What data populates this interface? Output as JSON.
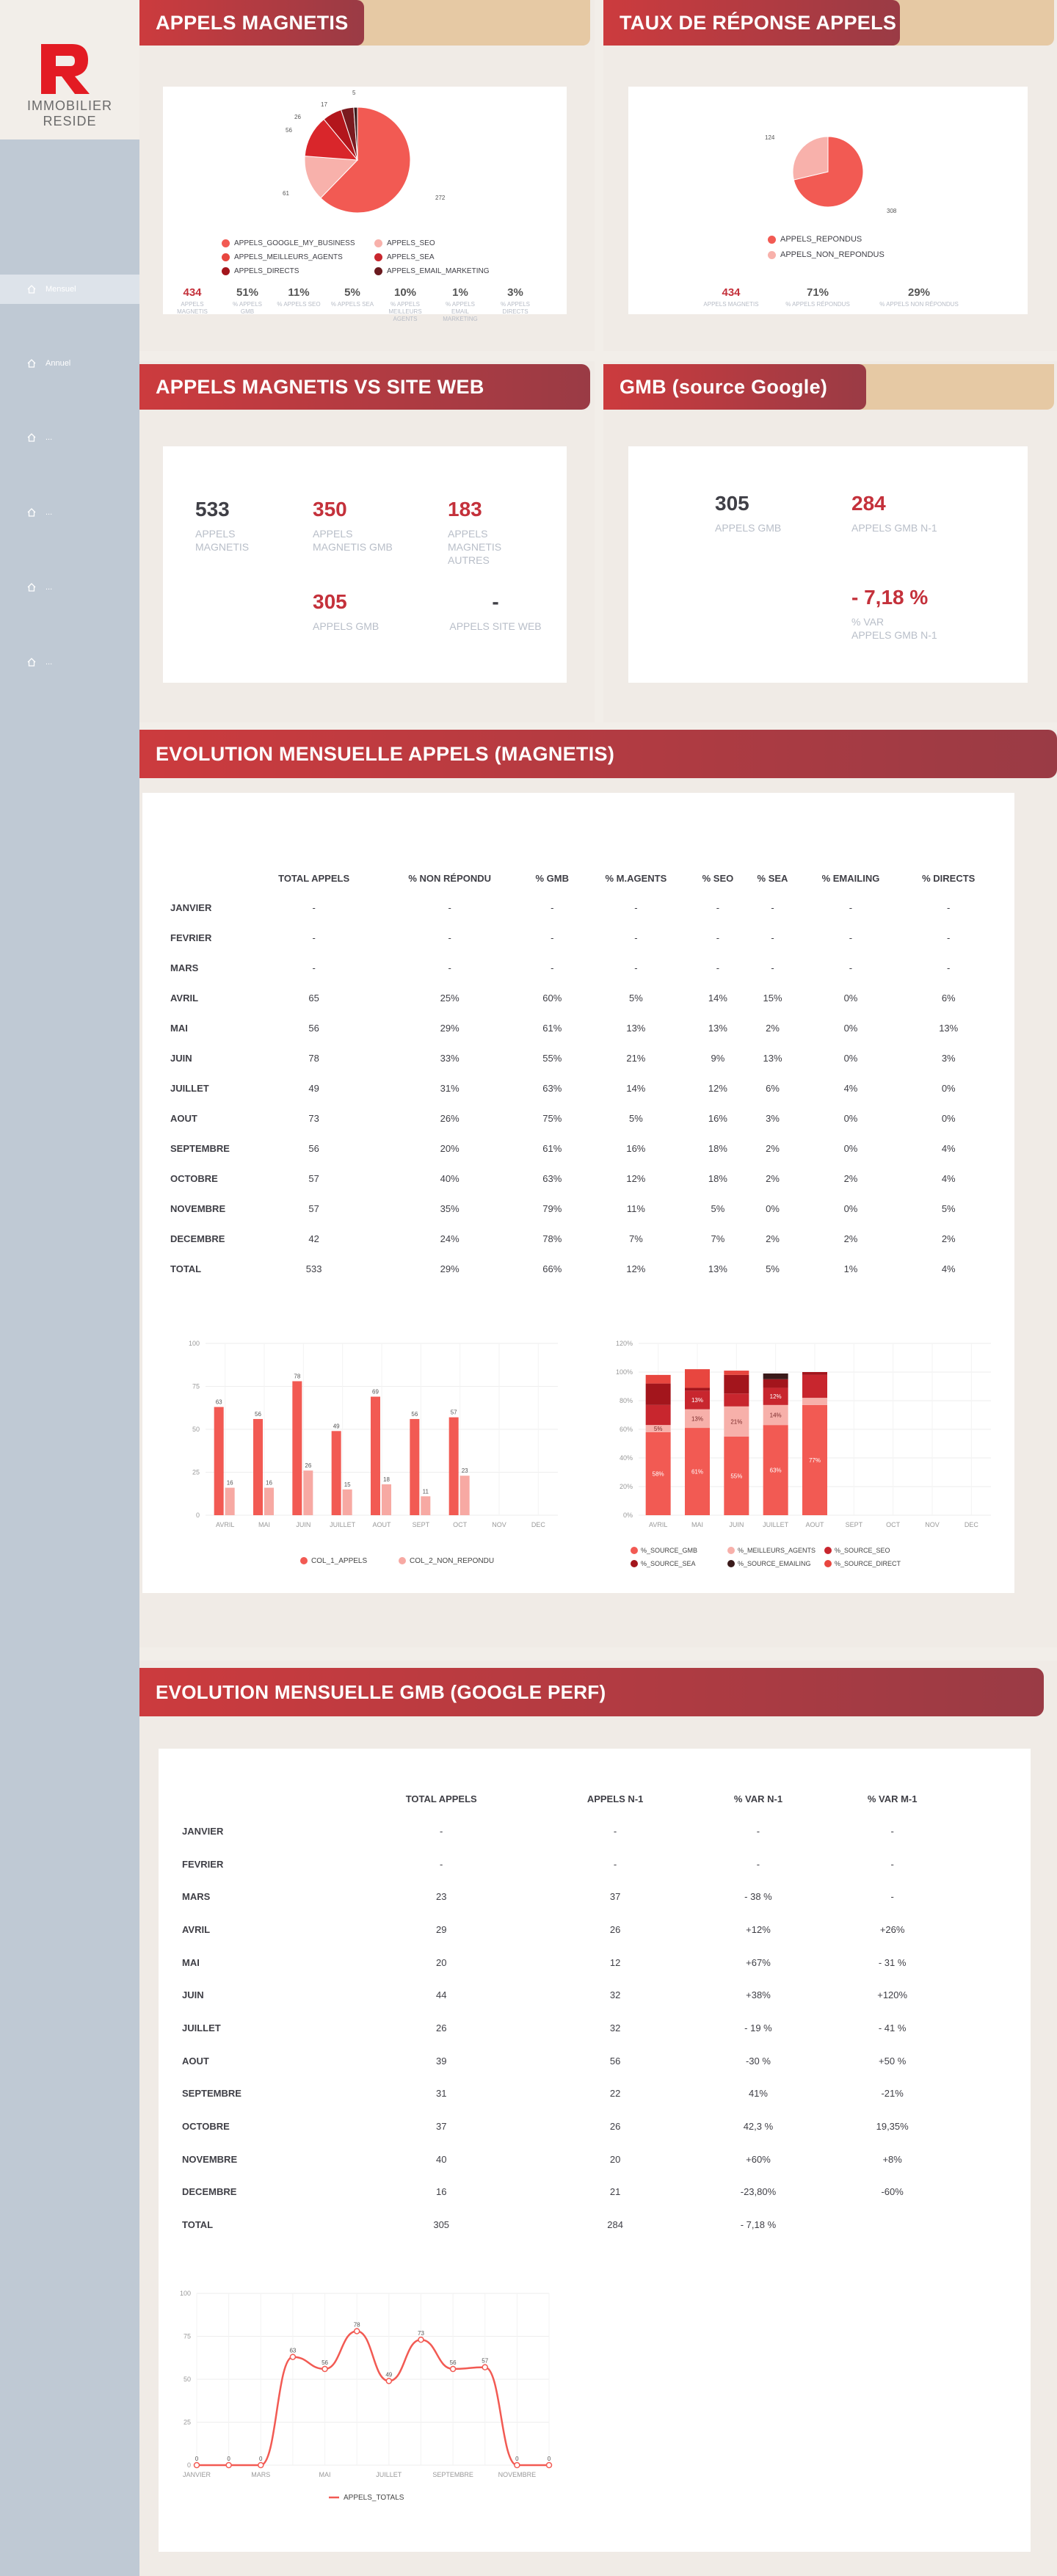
{
  "brand": {
    "line1": "IMMOBILIER",
    "line2": "RESIDE",
    "red": "#e31b23"
  },
  "nav": [
    {
      "label": "Mensuel",
      "icon": "home-icon",
      "active": true
    },
    {
      "label": "Annuel",
      "icon": "home-icon",
      "active": false
    },
    {
      "label": "...",
      "icon": "home-icon",
      "active": false
    },
    {
      "label": "...",
      "icon": "home-icon",
      "active": false
    },
    {
      "label": "...",
      "icon": "home-icon",
      "active": false
    },
    {
      "label": "...",
      "icon": "home-icon",
      "active": false
    }
  ],
  "sections": {
    "magnetis": "APPELS MAGNETIS",
    "taux": "TAUX DE RÉPONSE APPELS",
    "vs": "APPELS MAGNETIS VS SITE WEB",
    "gmb": "GMB (source Google)",
    "evo_magnetis": "EVOLUTION MENSUELLE APPELS (MAGNETIS)",
    "evo_gmb": "EVOLUTION MENSUELLE GMB (GOOGLE PERF)"
  },
  "pie1": {
    "labels_vals": [
      "5",
      "17",
      "26",
      "56",
      "61",
      "272"
    ],
    "legend": [
      "APPELS_GOOGLE_MY_BUSINESS",
      "APPELS_SEO",
      "APPELS_MEILLEURS_AGENTS",
      "APPELS_SEA",
      "APPELS_DIRECTS",
      "APPELS_EMAIL_MARKETING"
    ],
    "kpis": [
      {
        "v": "434",
        "l": "APPELS MAGNETIS"
      },
      {
        "v": "51%",
        "l": "% APPELS GMB"
      },
      {
        "v": "11%",
        "l": "% APPELS SEO"
      },
      {
        "v": "5%",
        "l": "% APPELS SEA"
      },
      {
        "v": "10%",
        "l": "% APPELS MEILLEURS AGENTS"
      },
      {
        "v": "1%",
        "l": "% APPELS EMAIL MARKETING"
      },
      {
        "v": "3%",
        "l": "% APPELS DIRECTS"
      }
    ]
  },
  "pie2": {
    "labels_vals": [
      "124",
      "308"
    ],
    "legend": [
      "APPELS_REPONDUS",
      "APPELS_NON_REPONDUS"
    ],
    "kpis": [
      {
        "v": "434",
        "l": "APPELS MAGNETIS"
      },
      {
        "v": "71%",
        "l": "% APPELS RÉPONDUS"
      },
      {
        "v": "29%",
        "l": "% APPELS NON RÉPONDUS"
      }
    ]
  },
  "vs": [
    {
      "v": "533",
      "l": "APPELS MAGNETIS",
      "red": false
    },
    {
      "v": "350",
      "l": "APPELS MAGNETIS GMB",
      "red": true
    },
    {
      "v": "183",
      "l": "APPELS MAGNETIS AUTRES",
      "red": true
    },
    {
      "v": "305",
      "l": "APPELS GMB",
      "red": true
    },
    {
      "v": "-",
      "l": "APPELS SITE WEB",
      "red": false
    }
  ],
  "gmb": [
    {
      "v": "305",
      "l": "APPELS GMB",
      "red": false
    },
    {
      "v": "284",
      "l": "APPELS GMB N-1",
      "red": true
    },
    {
      "v": "- 7,18 %",
      "l": "% VAR\nAPPELS GMB N-1",
      "red": true
    }
  ],
  "table1": {
    "headers": [
      "",
      "TOTAL APPELS",
      "% NON RÉPONDU",
      "% GMB",
      "% M.AGENTS",
      "% SEO",
      "% SEA",
      "% EMAILING",
      "% DIRECTS"
    ],
    "rows": [
      [
        "JANVIER",
        "-",
        "-",
        "-",
        "-",
        "-",
        "-",
        "-",
        "-"
      ],
      [
        "FEVRIER",
        "-",
        "-",
        "-",
        "-",
        "-",
        "-",
        "-",
        "-"
      ],
      [
        "MARS",
        "-",
        "-",
        "-",
        "-",
        "-",
        "-",
        "-",
        "-"
      ],
      [
        "AVRIL",
        "65",
        "25%",
        "60%",
        "5%",
        "14%",
        "15%",
        "0%",
        "6%"
      ],
      [
        "MAI",
        "56",
        "29%",
        "61%",
        "13%",
        "13%",
        "2%",
        "0%",
        "13%"
      ],
      [
        "JUIN",
        "78",
        "33%",
        "55%",
        "21%",
        "9%",
        "13%",
        "0%",
        "3%"
      ],
      [
        "JUILLET",
        "49",
        "31%",
        "63%",
        "14%",
        "12%",
        "6%",
        "4%",
        "0%"
      ],
      [
        "AOUT",
        "73",
        "26%",
        "75%",
        "5%",
        "16%",
        "3%",
        "0%",
        "0%"
      ],
      [
        "SEPTEMBRE",
        "56",
        "20%",
        "61%",
        "16%",
        "18%",
        "2%",
        "0%",
        "4%"
      ],
      [
        "OCTOBRE",
        "57",
        "40%",
        "63%",
        "12%",
        "18%",
        "2%",
        "2%",
        "4%"
      ],
      [
        "NOVEMBRE",
        "57",
        "35%",
        "79%",
        "11%",
        "5%",
        "0%",
        "0%",
        "5%"
      ],
      [
        "DECEMBRE",
        "42",
        "24%",
        "78%",
        "7%",
        "7%",
        "2%",
        "2%",
        "2%"
      ],
      [
        "TOTAL",
        "533",
        "29%",
        "66%",
        "12%",
        "13%",
        "5%",
        "1%",
        "4%"
      ]
    ]
  },
  "table2": {
    "headers": [
      "",
      "TOTAL APPELS",
      "APPELS N-1",
      "% VAR N-1",
      "% VAR M-1"
    ],
    "rows": [
      [
        "JANVIER",
        "-",
        "-",
        "-",
        "-"
      ],
      [
        "FEVRIER",
        "-",
        "-",
        "-",
        "-"
      ],
      [
        "MARS",
        "23",
        "37",
        "- 38 %",
        "-"
      ],
      [
        "AVRIL",
        "29",
        "26",
        "+12%",
        "+26%"
      ],
      [
        "MAI",
        "20",
        "12",
        "+67%",
        "- 31 %"
      ],
      [
        "JUIN",
        "44",
        "32",
        "+38%",
        "+120%"
      ],
      [
        "JUILLET",
        "26",
        "32",
        "- 19 %",
        "- 41 %"
      ],
      [
        "AOUT",
        "39",
        "56",
        "-30 %",
        "+50 %"
      ],
      [
        "SEPTEMBRE",
        "31",
        "22",
        "41%",
        "-21%"
      ],
      [
        "OCTOBRE",
        "37",
        "26",
        "42,3 %",
        "19,35%"
      ],
      [
        "NOVEMBRE",
        "40",
        "20",
        "+60%",
        "+8%"
      ],
      [
        "DECEMBRE",
        "16",
        "21",
        "-23,80%",
        "-60%"
      ],
      [
        "TOTAL",
        "305",
        "284",
        "- 7,18 %",
        ""
      ]
    ]
  },
  "chart_data": [
    {
      "type": "bar",
      "categories": [
        "AVRIL",
        "MAI",
        "JUIN",
        "JUILLET",
        "AOUT",
        "SEPT",
        "OCT",
        "NOV",
        "DEC"
      ],
      "series": [
        {
          "name": "COL_1_APPELS",
          "values": [
            63,
            56,
            78,
            49,
            69,
            56,
            57,
            null,
            null
          ],
          "color": "#f25a53"
        },
        {
          "name": "COL_2_NON_REPONDU",
          "values": [
            16,
            16,
            26,
            15,
            18,
            11,
            23,
            null,
            null
          ],
          "color": "#f7a9a3"
        }
      ],
      "yticks": [
        "0",
        "25",
        "50",
        "75",
        "100"
      ],
      "ylim": [
        0,
        100
      ]
    },
    {
      "type": "bar",
      "stacked": true,
      "categories": [
        "AVRIL",
        "MAI",
        "JUIN",
        "JUILLET",
        "AOUT",
        "SEPT",
        "OCT",
        "NOV",
        "DEC"
      ],
      "series": [
        {
          "name": "%_SOURCE_GMB",
          "values": [
            58,
            61,
            55,
            63,
            77,
            null,
            null,
            null,
            null
          ],
          "labels": [
            "58%",
            "61%",
            "55%",
            "63%",
            "77%"
          ],
          "color": "#f25a53"
        },
        {
          "name": "%_MEILLEURS_AGENTS",
          "values": [
            5,
            13,
            21,
            14,
            5,
            null,
            null,
            null,
            null
          ],
          "labels": [
            "5%",
            "13%",
            "21%",
            "14%",
            ""
          ],
          "color": "#f7b0aa"
        },
        {
          "name": "%_SOURCE_SEO",
          "values": [
            14,
            13,
            9,
            12,
            16,
            null,
            null,
            null,
            null
          ],
          "labels": [
            "",
            "13%",
            "",
            "12%",
            ""
          ],
          "color": "#c8262e"
        },
        {
          "name": "%_SOURCE_SEA",
          "values": [
            15,
            2,
            13,
            6,
            2,
            null,
            null,
            null,
            null
          ],
          "labels": [
            "",
            "",
            "",
            "",
            ""
          ],
          "color": "#a3151c"
        },
        {
          "name": "%_SOURCE_EMAILING",
          "values": [
            0,
            0,
            0,
            4,
            0,
            null,
            null,
            null,
            null
          ],
          "labels": [
            "",
            "",
            "",
            "",
            ""
          ],
          "color": "#3a1a1a"
        },
        {
          "name": "%_SOURCE_DIRECT",
          "values": [
            6,
            13,
            3,
            0,
            0,
            null,
            null,
            null,
            null
          ],
          "labels": [
            "",
            "",
            "",
            "",
            ""
          ],
          "color": "#e8463f"
        }
      ],
      "yticks": [
        "0%",
        "20%",
        "40%",
        "60%",
        "80%",
        "100%",
        "120%"
      ],
      "ylim": [
        0,
        120
      ]
    },
    {
      "type": "line",
      "categories": [
        "JANVIER",
        "",
        "MARS",
        "",
        "MAI",
        "",
        "JUILLET",
        "",
        "SEPTEMBRE",
        "",
        "NOVEMBRE",
        ""
      ],
      "series": [
        {
          "name": "APPELS_TOTALS",
          "values": [
            0,
            0,
            0,
            63,
            56,
            78,
            49,
            73,
            56,
            57,
            0,
            0
          ],
          "color": "#f25a53"
        }
      ],
      "yticks": [
        "0",
        "25",
        "50",
        "75",
        "100"
      ],
      "ylim": [
        0,
        100
      ]
    }
  ]
}
